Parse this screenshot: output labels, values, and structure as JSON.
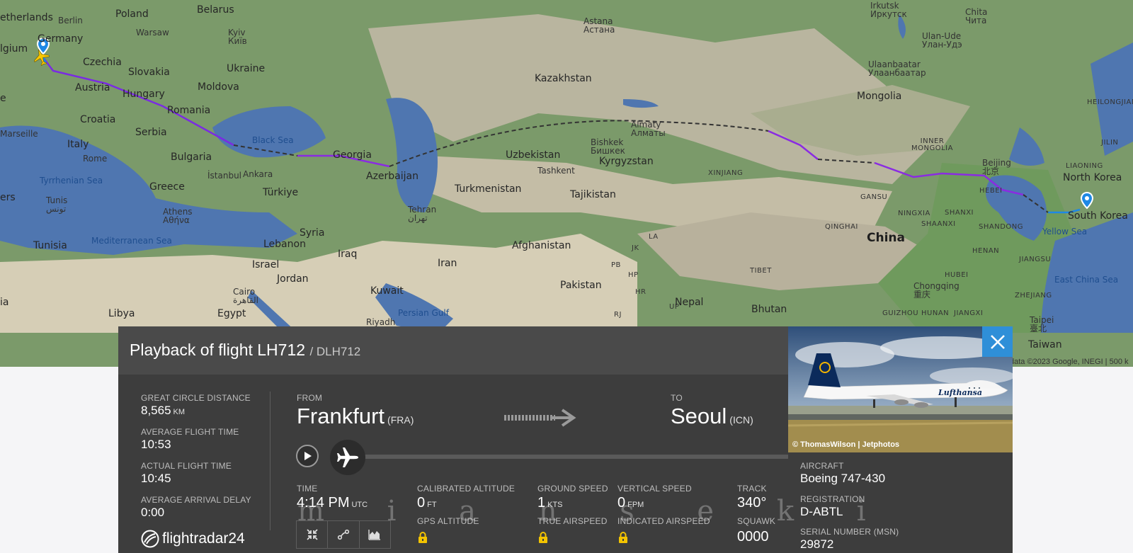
{
  "map": {
    "labels": {
      "netherlands": "etherlands",
      "berlin": "Berlin",
      "poland": "Poland",
      "belarus": "Belarus",
      "belgium": "lgium",
      "germany": "Germany",
      "warsaw": "Warsaw",
      "kyiv": "Kyiv\nКиїв",
      "czechia": "Czechia",
      "slovakia": "Slovakia",
      "ukraine": "Ukraine",
      "austria": "Austria",
      "hungary": "Hungary",
      "moldova": "Moldova",
      "romania": "Romania",
      "croatia": "Croatia",
      "serbia": "Serbia",
      "marseille": "Marseille",
      "italy": "Italy",
      "rome": "Rome",
      "bulgaria": "Bulgaria",
      "black_sea": "Black Sea",
      "georgia": "Georgia",
      "istanbul": "İstanbul",
      "ankara": "Ankara",
      "tyrrhenian": "Tyrrhenian Sea",
      "greece": "Greece",
      "turkiye": "Türkiye",
      "azerbaijan": "Azerbaijan",
      "tunis": "Tunis\nتونس",
      "athens": "Athens\nΑθήνα",
      "mediterranean": "Mediterranean Sea",
      "tunisia": "Tunisia",
      "syria": "Syria",
      "lebanon": "Lebanon",
      "israel": "Israel",
      "jordan": "Jordan",
      "iraq": "Iraq",
      "iran": "Iran",
      "tehran": "Tehran\nتهران",
      "kuwait": "Kuwait",
      "cairo": "Cairo\nالقاهرة",
      "libya": "Libya",
      "egypt": "Egypt",
      "riyadh": "Riyadh",
      "persian_gulf": "Persian Gulf",
      "kazakhstan": "Kazakhstan",
      "astana": "Astana\nАстана",
      "uzbekistan": "Uzbekistan",
      "turkmenistan": "Turkmenistan",
      "tashkent": "Tashkent",
      "bishkek": "Bishkek\nБишкек",
      "almaty": "Almaty\nАлматы",
      "kyrgyzstan": "Kyrgyzstan",
      "tajikistan": "Tajikistan",
      "afghanistan": "Afghanistan",
      "pakistan": "Pakistan",
      "nepal": "Nepal",
      "bhutan": "Bhutan",
      "xinjiang": "XINJIANG",
      "gansu": "GANSU",
      "qinghai": "QINGHAI",
      "tibet": "TIBET",
      "ningxia": "NINGXIA",
      "shaanxi": "SHAANXI",
      "shanxi": "SHANXI",
      "hebei": "HEBEI",
      "shandong": "SHANDONG",
      "henan": "HENAN",
      "hubei": "HUBEI",
      "jiangsu": "JIANGSU",
      "zhejiang": "ZHEJIANG",
      "chongqing": "Chongqing\n重庆",
      "guizhou": "GUIZHOU",
      "hunan": "HUNAN",
      "jiangxi": "JIANGXI",
      "china": "China",
      "beijing": "Beijing\n北京",
      "inner_mongolia": "INNER\nMONGOLIA",
      "mongolia": "Mongolia",
      "ulaanbaatar": "Ulaanbaatar\nУлаанбаатар",
      "ulan_ude": "Ulan-Ude\nУлан-Удэ",
      "irkutsk": "Irkutsk\nИркутск",
      "chita": "Chita\nЧита",
      "heilongjiang": "HEILONGJIAN",
      "jilin": "JILIN",
      "liaoning": "LIAONING",
      "north_korea": "North Korea",
      "south_korea": "South Korea",
      "yellow_sea": "Yellow Sea",
      "east_china_sea": "East China Sea",
      "taipei": "Taipei\n臺北",
      "taiwan": "Taiwan",
      "ira": "ia",
      "ers": "ers",
      "sa": "e",
      "pb": "PB",
      "hp": "HP",
      "hr": "HR",
      "rj": "RJ",
      "jk": "JK",
      "la": "LA",
      "up": "UP"
    },
    "copyright": "data ©2023 Google, INEGI  |  500 k"
  },
  "panel": {
    "title": "Playback of flight LH712",
    "subtitle": "/ DLH712",
    "great_circle_distance_label": "GREAT CIRCLE DISTANCE",
    "great_circle_distance_value": "8,565",
    "great_circle_distance_unit": "KM",
    "average_flight_time_label": "AVERAGE FLIGHT TIME",
    "average_flight_time_value": "10:53",
    "actual_flight_time_label": "ACTUAL FLIGHT TIME",
    "actual_flight_time_value": "10:45",
    "average_arrival_delay_label": "AVERAGE ARRIVAL DELAY",
    "average_arrival_delay_value": "0:00",
    "from_label": "FROM",
    "from_city": "Frankfurt",
    "from_code": "(FRA)",
    "to_label": "TO",
    "to_city": "Seoul",
    "to_code": "(ICN)",
    "time_label": "TIME",
    "time_value": "4:14 PM",
    "time_unit": "UTC",
    "calibrated_altitude_label": "CALIBRATED ALTITUDE",
    "calibrated_altitude_value": "0",
    "calibrated_altitude_unit": "FT",
    "gps_altitude_label": "GPS ALTITUDE",
    "ground_speed_label": "GROUND SPEED",
    "ground_speed_value": "1",
    "ground_speed_unit": "KTS",
    "true_airspeed_label": "TRUE AIRSPEED",
    "vertical_speed_label": "VERTICAL SPEED",
    "vertical_speed_value": "0",
    "vertical_speed_unit": "FPM",
    "indicated_airspeed_label": "INDICATED AIRSPEED",
    "track_label": "TRACK",
    "track_value": "340°",
    "squawk_label": "SQUAWK",
    "squawk_value": "0000",
    "logo_text": "flightradar24",
    "playback_progress": 0
  },
  "aircraft_panel": {
    "photo_credit": "© ThomasWilson | Jetphotos",
    "aircraft_label": "AIRCRAFT",
    "aircraft_value": "Boeing 747-430",
    "registration_label": "REGISTRATION",
    "registration_value": "D-ABTL",
    "serial_label": "SERIAL NUMBER (MSN)",
    "serial_value": "29872",
    "livery_text": "Lufthansa"
  },
  "watermark": "m i a n s e k i",
  "colors": {
    "accent": "#2f8fd8",
    "route_flown": "#8a2be2",
    "route_gap": "#333333",
    "panel_bg": "#3d3d3d"
  }
}
